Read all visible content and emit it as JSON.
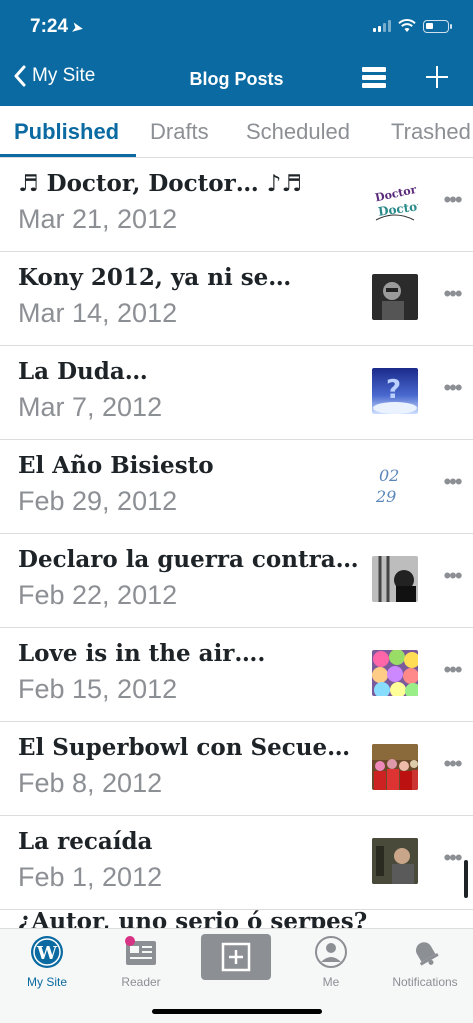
{
  "status": {
    "time": "7:24"
  },
  "nav": {
    "back_label": "My Site",
    "title": "Blog Posts"
  },
  "tabs": [
    {
      "label": "Published",
      "active": true
    },
    {
      "label": "Drafts"
    },
    {
      "label": "Scheduled"
    },
    {
      "label": "Trashed"
    }
  ],
  "posts": [
    {
      "title": "♬ Doctor, Doctor… ♪♬",
      "date": "Mar 21, 2012",
      "thumb": "doctor-doctor-text-image"
    },
    {
      "title": "Kony 2012, ya ni se…",
      "date": "Mar 14, 2012",
      "thumb": "portrait-photo"
    },
    {
      "title": "La Duda…",
      "date": "Mar 7, 2012",
      "thumb": "question-mark-clouds-image"
    },
    {
      "title": "El Año Bisiesto",
      "date": "Feb 29, 2012",
      "thumb": "02-29-date-image"
    },
    {
      "title": "Declaro la guerra contra…",
      "date": "Feb 22, 2012",
      "thumb": "black-white-photo"
    },
    {
      "title": "Love is in the air….",
      "date": "Feb 15, 2012",
      "thumb": "candy-hearts-photo"
    },
    {
      "title": "El Superbowl con Secue…",
      "date": "Feb 8, 2012",
      "thumb": "group-photo"
    },
    {
      "title": "La recaída",
      "date": "Feb 1, 2012",
      "thumb": "person-photo"
    }
  ],
  "partial_post": {
    "title": "¿Autor, uno serio ó serpes?"
  },
  "tabbar": [
    {
      "label": "My Site",
      "icon": "wordpress-icon",
      "active": true
    },
    {
      "label": "Reader",
      "icon": "reader-icon"
    },
    {
      "label": "",
      "icon": "new-post-icon"
    },
    {
      "label": "Me",
      "icon": "me-icon"
    },
    {
      "label": "Notifications",
      "icon": "bell-icon"
    }
  ],
  "colors": {
    "brand": "#0a6aa1",
    "muted": "#8c8f94",
    "text": "#1d2327",
    "badge": "#d63384"
  }
}
